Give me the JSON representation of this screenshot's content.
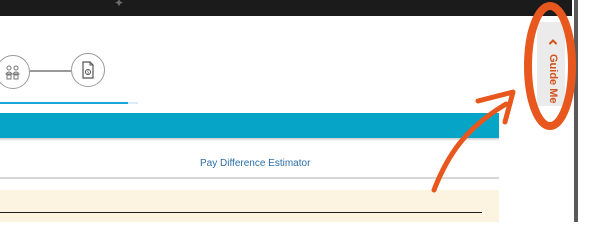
{
  "header": {
    "icon": "settings-icon"
  },
  "stepper": {
    "steps": [
      {
        "icon": "people-chart-icon"
      },
      {
        "icon": "money-document-icon"
      }
    ],
    "progress_percent": 100
  },
  "main": {
    "section_link": "Pay Difference Estimator"
  },
  "guide_me": {
    "label": "Guide Me",
    "icon": "chevron-left-icon"
  },
  "colors": {
    "accent": "#06a5c8",
    "progress": "#1aa7d9",
    "guide_text": "#d2531c",
    "annotation": "#e8571d",
    "alert_bg": "#fcf3e1"
  }
}
